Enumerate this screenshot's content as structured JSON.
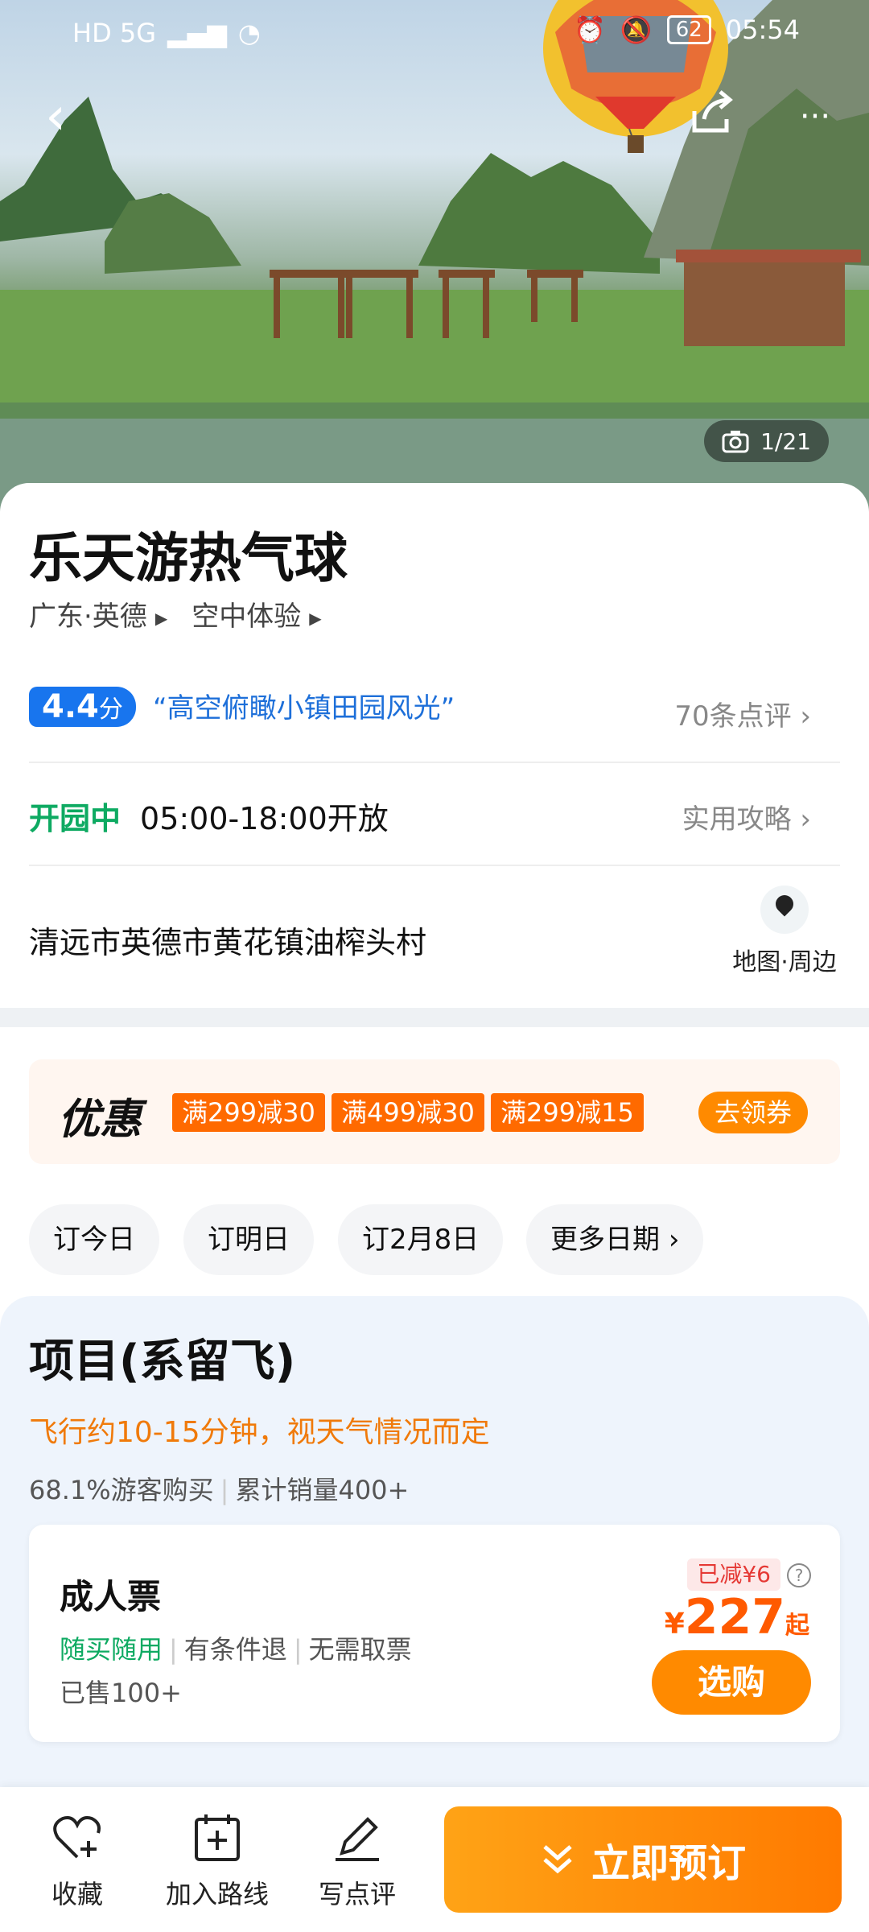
{
  "statusbar": {
    "left_icons": "HD 5G",
    "battery": "62",
    "time": "05:54"
  },
  "hero": {
    "photo_counter": "1/21"
  },
  "attraction": {
    "name": "乐天游热气球",
    "region": "广东·英德",
    "category": "空中体验"
  },
  "review": {
    "score": "4.4",
    "score_unit": "分",
    "quote": "“高空俯瞰小镇田园风光”",
    "count_text": "70条点评"
  },
  "hours": {
    "status": "开园中",
    "time": "05:00-18:00开放",
    "guide_link": "实用攻略"
  },
  "location": {
    "address": "清远市英德市黄花镇油榨头村",
    "map_link": "地图·周边"
  },
  "promo": {
    "title": "优惠",
    "tags": [
      "满299减30",
      "满499减30",
      "满299减15"
    ],
    "button": "去领券"
  },
  "dates": {
    "items": [
      "订今日",
      "订明日",
      "订2月8日",
      "更多日期"
    ]
  },
  "project": {
    "title": "项目(系留飞)",
    "note": "飞行约10-15分钟，视天气情况而定",
    "buy_rate": "68.1%游客购买",
    "sales": "累计销量400+",
    "ticket": {
      "name": "成人票",
      "tags": [
        "随买随用",
        "有条件退",
        "无需取票"
      ],
      "sold": "已售100+",
      "discount": "已减¥6",
      "currency": "¥",
      "price": "227",
      "price_suffix": "起",
      "button": "选购"
    }
  },
  "bottom_bar": {
    "favorite": "收藏",
    "add_route": "加入路线",
    "write_review": "写点评",
    "book": "立即预订"
  }
}
